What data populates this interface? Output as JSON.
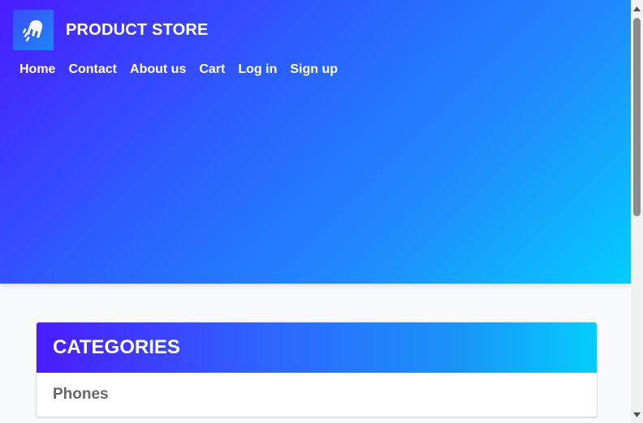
{
  "header": {
    "brand_name": "PRODUCT STORE",
    "logo_icon": "rocket-icon",
    "nav": [
      {
        "label": "Home"
      },
      {
        "label": "Contact"
      },
      {
        "label": "About us"
      },
      {
        "label": "Cart"
      },
      {
        "label": "Log in"
      },
      {
        "label": "Sign up"
      }
    ]
  },
  "categories": {
    "title": "CATEGORIES",
    "items": [
      {
        "label": "Phones"
      }
    ]
  },
  "colors": {
    "gradient_start": "#4a1bff",
    "gradient_end": "#04cdfd",
    "page_background": "#f7f9fc",
    "category_text": "#666666"
  }
}
